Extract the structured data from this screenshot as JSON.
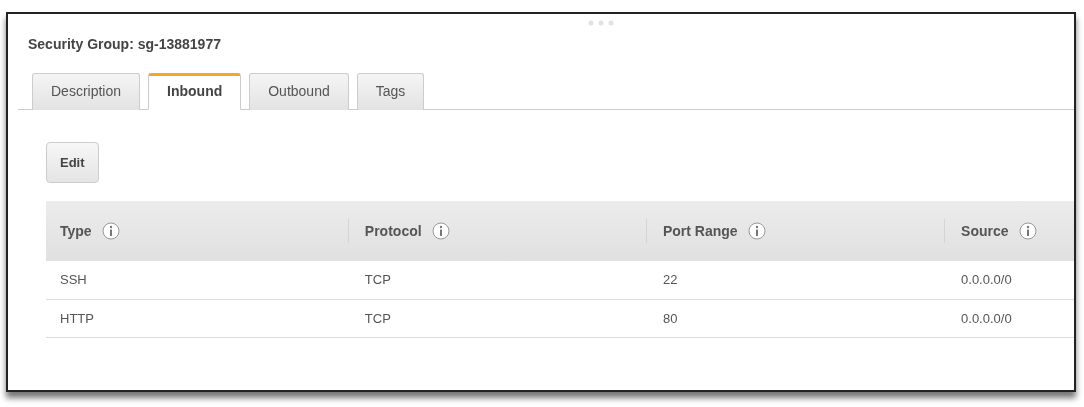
{
  "panel": {
    "title": "Security Group: sg-13881977"
  },
  "tabs": [
    {
      "label": "Description",
      "selected": false
    },
    {
      "label": "Inbound",
      "selected": true
    },
    {
      "label": "Outbound",
      "selected": false
    },
    {
      "label": "Tags",
      "selected": false
    }
  ],
  "toolbar": {
    "buttons": [
      "Edit"
    ]
  },
  "table": {
    "columns": [
      "Type",
      "Protocol",
      "Port Range",
      "Source"
    ],
    "rows": [
      [
        "SSH",
        "TCP",
        "22",
        "0.0.0.0/0"
      ],
      [
        "HTTP",
        "TCP",
        "80",
        "0.0.0.0/0"
      ]
    ]
  }
}
